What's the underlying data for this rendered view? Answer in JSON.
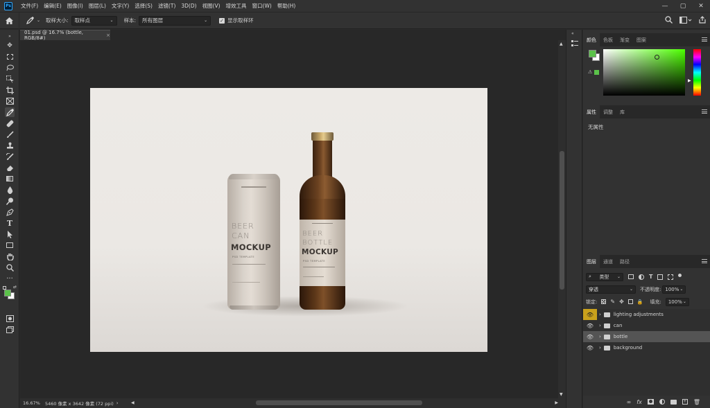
{
  "menu": {
    "logo": "Ps",
    "items": [
      "文件(F)",
      "编辑(E)",
      "图像(I)",
      "图层(L)",
      "文字(Y)",
      "选择(S)",
      "滤镜(T)",
      "3D(D)",
      "视图(V)",
      "增效工具",
      "窗口(W)",
      "帮助(H)"
    ],
    "window_controls": [
      "—",
      "▢",
      "✕"
    ]
  },
  "options": {
    "sample_size_label": "取样大小:",
    "sample_size_value": "取样点",
    "sample_label": "样本:",
    "sample_value": "所有图层",
    "show_ring_label": "显示取样环"
  },
  "document": {
    "tab_title": "01.psd @ 16.7% (bottle, RGB/8#)",
    "tab_close": "×",
    "zoom": "16.67%",
    "dimensions": "5460 像素 x 3642 像素 (72 ppi)"
  },
  "mockup": {
    "can_line1": "BEER",
    "can_line2": "CAN",
    "can_line3": "MOCKUP",
    "can_small": "PSD TEMPLATE",
    "bottle_line1": "BEER",
    "bottle_line2": "BOTTLE",
    "bottle_line3": "MOCKUP",
    "bottle_small": "PSD TEMPLATE"
  },
  "color_panel": {
    "tabs": [
      "颜色",
      "色板",
      "渐变",
      "图案"
    ],
    "foreground": "#5bc24a",
    "background": "#ffffff"
  },
  "properties_panel": {
    "tabs": [
      "属性",
      "调整",
      "库"
    ],
    "empty_text": "无属性"
  },
  "layers_panel": {
    "tabs": [
      "图层",
      "通道",
      "路径"
    ],
    "filter_kind": "类型",
    "blend_mode": "穿透",
    "opacity_label": "不透明度:",
    "opacity_value": "100%",
    "lock_label": "锁定:",
    "fill_label": "填充:",
    "fill_value": "100%",
    "layers": [
      {
        "name": "lighting adjustments",
        "selected": false
      },
      {
        "name": "can",
        "selected": false
      },
      {
        "name": "bottle",
        "selected": true
      },
      {
        "name": "background",
        "selected": false
      }
    ],
    "footer_icons": [
      "link-icon",
      "fx-icon",
      "mask-icon",
      "adjustment-icon",
      "group-icon",
      "new-layer-icon",
      "trash-icon"
    ]
  }
}
